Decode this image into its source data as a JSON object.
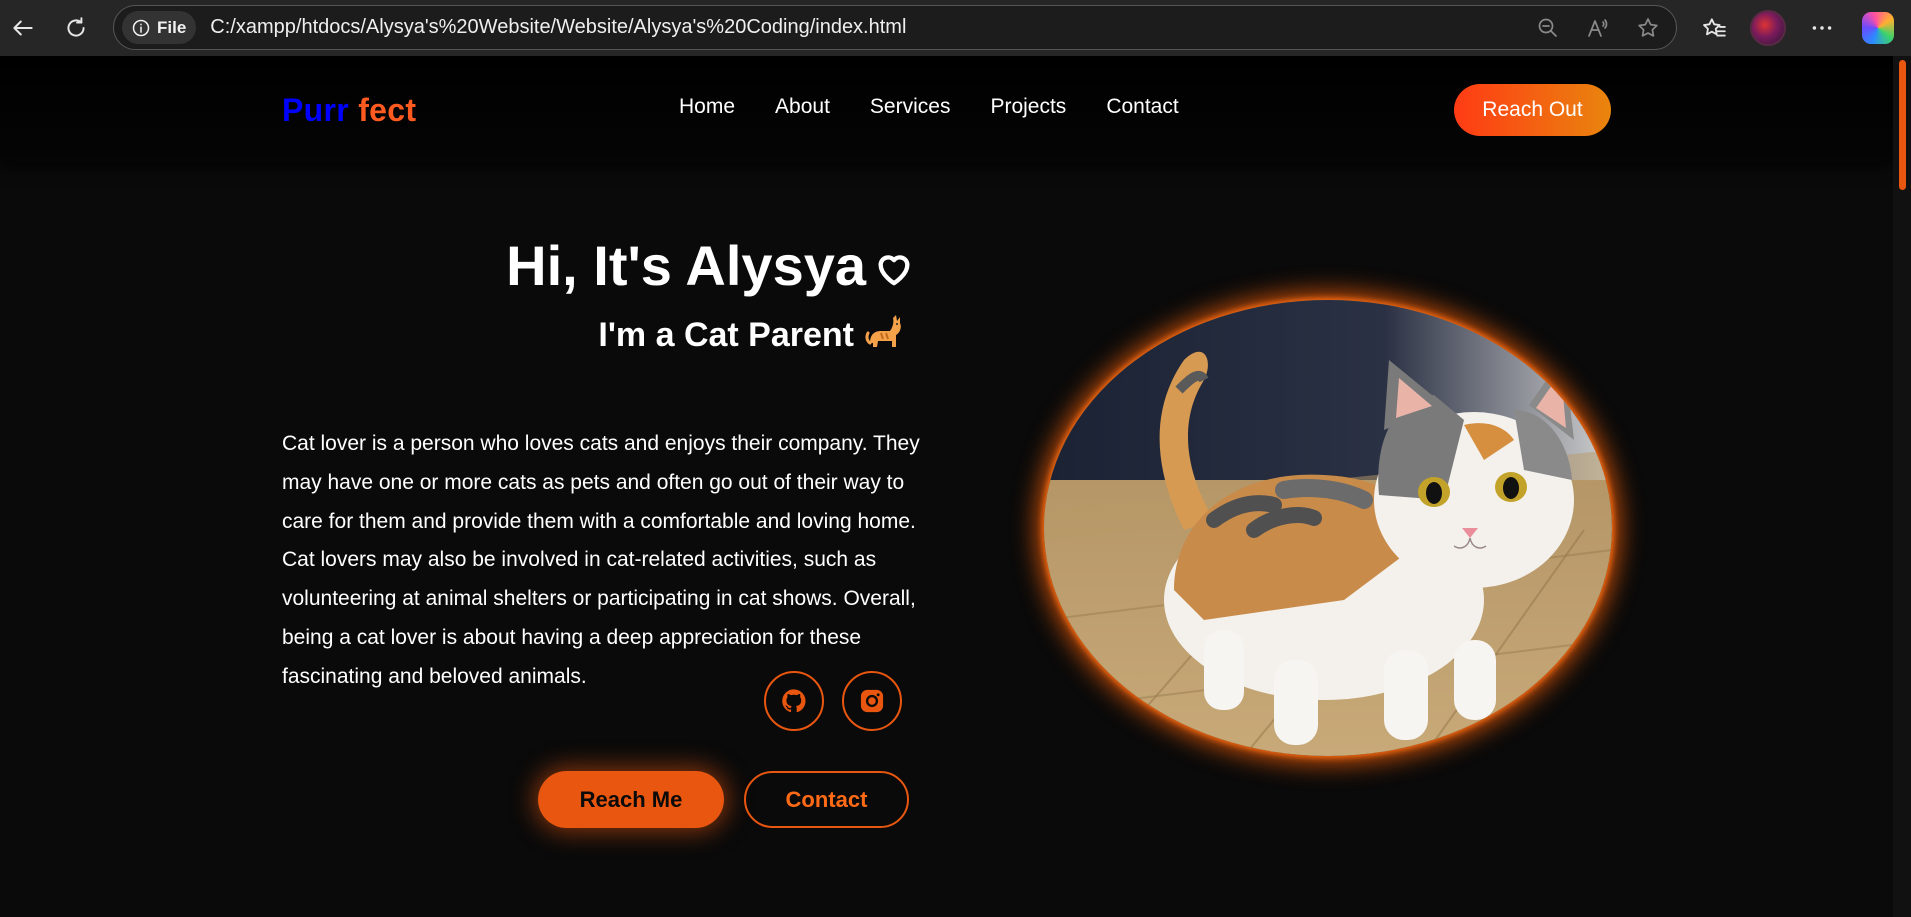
{
  "browser": {
    "site_info_label": "File",
    "url": "C:/xampp/htdocs/Alysya's%20Website/Website/Alysya's%20Coding/index.html",
    "icons": [
      "back-icon",
      "reload-icon",
      "info-icon",
      "zoom-out-icon",
      "read-aloud-icon",
      "favorite-star-icon",
      "favorites-icon",
      "profile-avatar",
      "more-icon",
      "copilot-icon"
    ]
  },
  "navbar": {
    "logo_part1": "Purr",
    "logo_part2": "fect",
    "links": [
      "Home",
      "About",
      "Services",
      "Projects",
      "Contact"
    ],
    "cta": "Reach Out"
  },
  "hero": {
    "title": "Hi, It's Alysya",
    "subtitle": "I'm a Cat Parent",
    "description": "Cat lover is a person who loves cats and enjoys their company. They may have one or more cats as pets and often go out of their way to care for them and provide them with a comfortable and loving home. Cat lovers may also be involved in cat-related activities, such as volunteering at animal shelters or participating in cat shows. Overall, being a cat lover is about having a deep appreciation for these fascinating and beloved animals.",
    "social_icons": [
      "github-icon",
      "instagram-icon"
    ],
    "primary_button": "Reach Me",
    "secondary_button": "Contact"
  },
  "colors": {
    "accent": "#e8560f",
    "logo_blue": "#0000ff",
    "logo_orange": "#ff5a1f",
    "background": "#0a0a0a"
  }
}
